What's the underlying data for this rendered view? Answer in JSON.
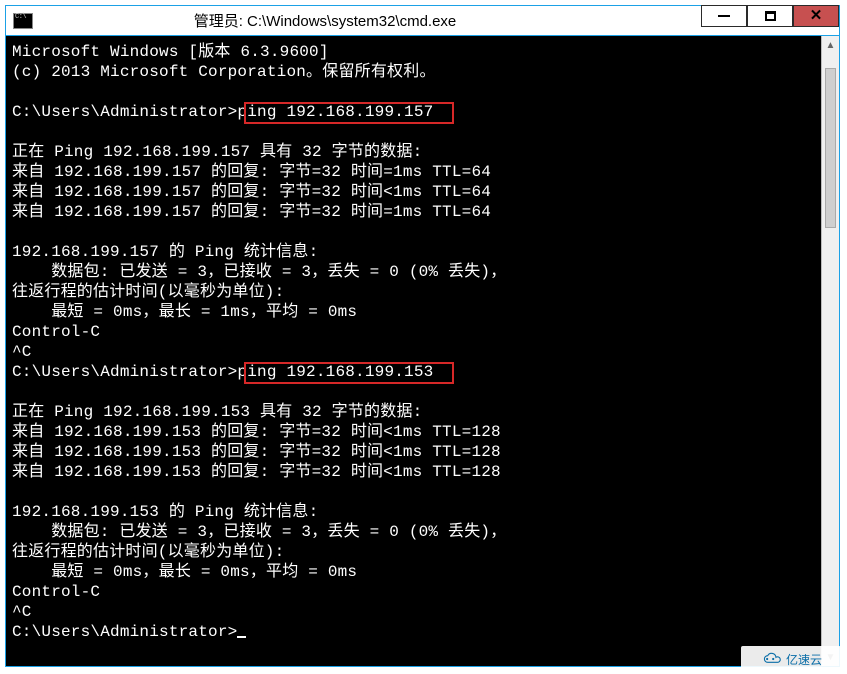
{
  "window": {
    "title": "管理员: C:\\Windows\\system32\\cmd.exe"
  },
  "controls": {
    "min": "minimize",
    "max": "maximize",
    "close": "close"
  },
  "scrollbar": {
    "up": "▲",
    "down": "▼"
  },
  "term": {
    "l01": "Microsoft Windows [版本 6.3.9600]",
    "l02": "(c) 2013 Microsoft Corporation。保留所有权利。",
    "l03": "",
    "l04": "C:\\Users\\Administrator>ping 192.168.199.157",
    "l05": "",
    "l06": "正在 Ping 192.168.199.157 具有 32 字节的数据:",
    "l07": "来自 192.168.199.157 的回复: 字节=32 时间=1ms TTL=64",
    "l08": "来自 192.168.199.157 的回复: 字节=32 时间<1ms TTL=64",
    "l09": "来自 192.168.199.157 的回复: 字节=32 时间=1ms TTL=64",
    "l10": "",
    "l11": "192.168.199.157 的 Ping 统计信息:",
    "l12": "    数据包: 已发送 = 3，已接收 = 3，丢失 = 0 (0% 丢失)，",
    "l13": "往返行程的估计时间(以毫秒为单位):",
    "l14": "    最短 = 0ms，最长 = 1ms，平均 = 0ms",
    "l15": "Control-C",
    "l16": "^C",
    "l17": "C:\\Users\\Administrator>ping 192.168.199.153",
    "l18": "",
    "l19": "正在 Ping 192.168.199.153 具有 32 字节的数据:",
    "l20": "来自 192.168.199.153 的回复: 字节=32 时间<1ms TTL=128",
    "l21": "来自 192.168.199.153 的回复: 字节=32 时间<1ms TTL=128",
    "l22": "来自 192.168.199.153 的回复: 字节=32 时间<1ms TTL=128",
    "l23": "",
    "l24": "192.168.199.153 的 Ping 统计信息:",
    "l25": "    数据包: 已发送 = 3，已接收 = 3，丢失 = 0 (0% 丢失)，",
    "l26": "往返行程的估计时间(以毫秒为单位):",
    "l27": "    最短 = 0ms，最长 = 0ms，平均 = 0ms",
    "l28": "Control-C",
    "l29": "^C",
    "l30": "C:\\Users\\Administrator>"
  },
  "highlights": {
    "cmd1": "ping 192.168.199.157",
    "cmd2": "ping 192.168.199.153"
  },
  "watermark": {
    "text": "亿速云"
  }
}
